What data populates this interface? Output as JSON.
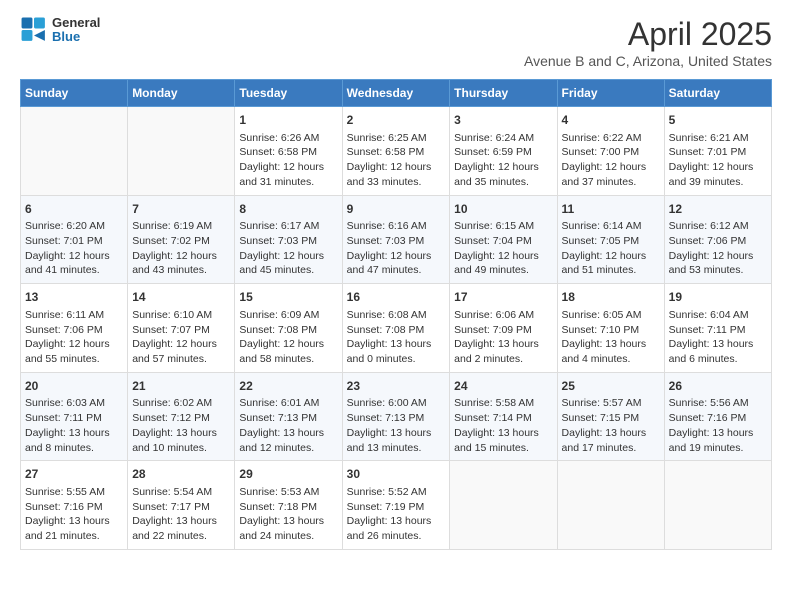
{
  "header": {
    "logo_general": "General",
    "logo_blue": "Blue",
    "title": "April 2025",
    "subtitle": "Avenue B and C, Arizona, United States"
  },
  "weekdays": [
    "Sunday",
    "Monday",
    "Tuesday",
    "Wednesday",
    "Thursday",
    "Friday",
    "Saturday"
  ],
  "weeks": [
    [
      {
        "day": "",
        "info": ""
      },
      {
        "day": "",
        "info": ""
      },
      {
        "day": "1",
        "info": "Sunrise: 6:26 AM\nSunset: 6:58 PM\nDaylight: 12 hours and 31 minutes."
      },
      {
        "day": "2",
        "info": "Sunrise: 6:25 AM\nSunset: 6:58 PM\nDaylight: 12 hours and 33 minutes."
      },
      {
        "day": "3",
        "info": "Sunrise: 6:24 AM\nSunset: 6:59 PM\nDaylight: 12 hours and 35 minutes."
      },
      {
        "day": "4",
        "info": "Sunrise: 6:22 AM\nSunset: 7:00 PM\nDaylight: 12 hours and 37 minutes."
      },
      {
        "day": "5",
        "info": "Sunrise: 6:21 AM\nSunset: 7:01 PM\nDaylight: 12 hours and 39 minutes."
      }
    ],
    [
      {
        "day": "6",
        "info": "Sunrise: 6:20 AM\nSunset: 7:01 PM\nDaylight: 12 hours and 41 minutes."
      },
      {
        "day": "7",
        "info": "Sunrise: 6:19 AM\nSunset: 7:02 PM\nDaylight: 12 hours and 43 minutes."
      },
      {
        "day": "8",
        "info": "Sunrise: 6:17 AM\nSunset: 7:03 PM\nDaylight: 12 hours and 45 minutes."
      },
      {
        "day": "9",
        "info": "Sunrise: 6:16 AM\nSunset: 7:03 PM\nDaylight: 12 hours and 47 minutes."
      },
      {
        "day": "10",
        "info": "Sunrise: 6:15 AM\nSunset: 7:04 PM\nDaylight: 12 hours and 49 minutes."
      },
      {
        "day": "11",
        "info": "Sunrise: 6:14 AM\nSunset: 7:05 PM\nDaylight: 12 hours and 51 minutes."
      },
      {
        "day": "12",
        "info": "Sunrise: 6:12 AM\nSunset: 7:06 PM\nDaylight: 12 hours and 53 minutes."
      }
    ],
    [
      {
        "day": "13",
        "info": "Sunrise: 6:11 AM\nSunset: 7:06 PM\nDaylight: 12 hours and 55 minutes."
      },
      {
        "day": "14",
        "info": "Sunrise: 6:10 AM\nSunset: 7:07 PM\nDaylight: 12 hours and 57 minutes."
      },
      {
        "day": "15",
        "info": "Sunrise: 6:09 AM\nSunset: 7:08 PM\nDaylight: 12 hours and 58 minutes."
      },
      {
        "day": "16",
        "info": "Sunrise: 6:08 AM\nSunset: 7:08 PM\nDaylight: 13 hours and 0 minutes."
      },
      {
        "day": "17",
        "info": "Sunrise: 6:06 AM\nSunset: 7:09 PM\nDaylight: 13 hours and 2 minutes."
      },
      {
        "day": "18",
        "info": "Sunrise: 6:05 AM\nSunset: 7:10 PM\nDaylight: 13 hours and 4 minutes."
      },
      {
        "day": "19",
        "info": "Sunrise: 6:04 AM\nSunset: 7:11 PM\nDaylight: 13 hours and 6 minutes."
      }
    ],
    [
      {
        "day": "20",
        "info": "Sunrise: 6:03 AM\nSunset: 7:11 PM\nDaylight: 13 hours and 8 minutes."
      },
      {
        "day": "21",
        "info": "Sunrise: 6:02 AM\nSunset: 7:12 PM\nDaylight: 13 hours and 10 minutes."
      },
      {
        "day": "22",
        "info": "Sunrise: 6:01 AM\nSunset: 7:13 PM\nDaylight: 13 hours and 12 minutes."
      },
      {
        "day": "23",
        "info": "Sunrise: 6:00 AM\nSunset: 7:13 PM\nDaylight: 13 hours and 13 minutes."
      },
      {
        "day": "24",
        "info": "Sunrise: 5:58 AM\nSunset: 7:14 PM\nDaylight: 13 hours and 15 minutes."
      },
      {
        "day": "25",
        "info": "Sunrise: 5:57 AM\nSunset: 7:15 PM\nDaylight: 13 hours and 17 minutes."
      },
      {
        "day": "26",
        "info": "Sunrise: 5:56 AM\nSunset: 7:16 PM\nDaylight: 13 hours and 19 minutes."
      }
    ],
    [
      {
        "day": "27",
        "info": "Sunrise: 5:55 AM\nSunset: 7:16 PM\nDaylight: 13 hours and 21 minutes."
      },
      {
        "day": "28",
        "info": "Sunrise: 5:54 AM\nSunset: 7:17 PM\nDaylight: 13 hours and 22 minutes."
      },
      {
        "day": "29",
        "info": "Sunrise: 5:53 AM\nSunset: 7:18 PM\nDaylight: 13 hours and 24 minutes."
      },
      {
        "day": "30",
        "info": "Sunrise: 5:52 AM\nSunset: 7:19 PM\nDaylight: 13 hours and 26 minutes."
      },
      {
        "day": "",
        "info": ""
      },
      {
        "day": "",
        "info": ""
      },
      {
        "day": "",
        "info": ""
      }
    ]
  ]
}
